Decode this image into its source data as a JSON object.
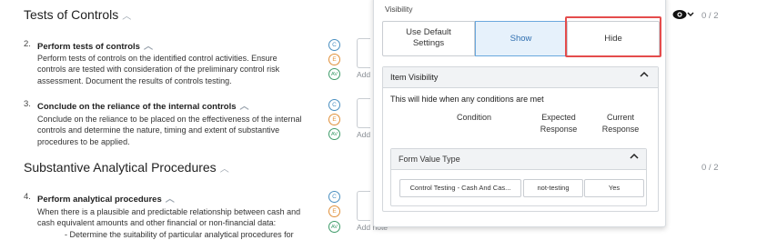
{
  "sections": [
    {
      "title": "Tests of Controls",
      "score": "0 / 2"
    },
    {
      "title": "Substantive Analytical Procedures",
      "score": "0 / 2"
    }
  ],
  "steps": [
    {
      "number": "2.",
      "title": "Perform tests of controls",
      "lines": [
        "Perform tests of controls on the identified control activities. Ensure",
        "controls are tested with consideration of the preliminary control risk",
        "assessment. Document the results of controls testing."
      ],
      "add_note": "Add"
    },
    {
      "number": "3.",
      "title": "Conclude on the reliance of the internal controls",
      "lines": [
        "Conclude on the reliance to be placed on the effectiveness of the internal",
        "controls and determine the nature, timing and extent of substantive",
        "procedures to be applied."
      ],
      "add_note": "Add"
    },
    {
      "number": "4.",
      "title": "Perform analytical procedures",
      "lines": [
        "When there is a plausible and predictable relationship between cash and",
        "cash equivalent amounts and other financial or non-financial data:",
        "- Determine the suitability of particular analytical procedures for"
      ],
      "add_note": "Add note"
    }
  ],
  "role_badges": {
    "c": "C",
    "e": "E",
    "av": "AV"
  },
  "popup": {
    "label": "Visibility",
    "options": {
      "default_line1": "Use Default",
      "default_line2": "Settings",
      "show": "Show",
      "hide": "Hide"
    },
    "selected": "Show",
    "item_visibility": {
      "title": "Item Visibility",
      "note": "This will hide when any conditions are met",
      "columns": {
        "condition": "Condition",
        "expected_1": "Expected",
        "expected_2": "Response",
        "current_1": "Current",
        "current_2": "Response"
      },
      "condition_group": {
        "title": "Form Value Type",
        "condition": "Control Testing - Cash And Cas...",
        "expected": "not-testing",
        "current": "Yes"
      }
    }
  },
  "colors": {
    "highlight_border": "#e44c4c",
    "selected_bg": "#e6f1fb",
    "selected_border": "#6aa8dd"
  }
}
